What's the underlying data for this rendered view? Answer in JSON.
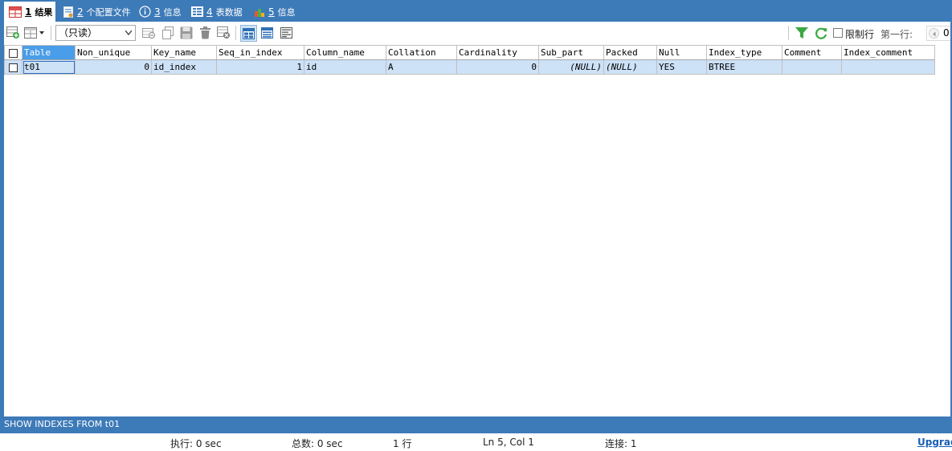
{
  "tabs": [
    {
      "num": "1",
      "label": "结果",
      "icon": "grid-result-icon",
      "active": true
    },
    {
      "num": "2",
      "label": "个配置文件",
      "icon": "profile-icon"
    },
    {
      "num": "3",
      "label": "信息",
      "icon": "info-icon"
    },
    {
      "num": "4",
      "label": "表数据",
      "icon": "table-data-icon"
    },
    {
      "num": "5",
      "label": "信息",
      "icon": "info-chart-icon"
    }
  ],
  "toolbar": {
    "mode_value": "（只读）",
    "limit_rows_label": "限制行",
    "first_row_label": "第一行:",
    "first_row_value": "0"
  },
  "grid": {
    "columns": [
      "Table",
      "Non_unique",
      "Key_name",
      "Seq_in_index",
      "Column_name",
      "Collation",
      "Cardinality",
      "Sub_part",
      "Packed",
      "Null",
      "Index_type",
      "Comment",
      "Index_comment"
    ],
    "rows": [
      [
        "t01",
        "0",
        "id_index",
        "1",
        "id",
        "A",
        "0",
        "(NULL)",
        "(NULL)",
        "YES",
        "BTREE",
        "",
        ""
      ]
    ]
  },
  "sql_text": "SHOW INDEXES FROM t01",
  "status": {
    "exec": "执行: 0 sec",
    "total": "总数: 0 sec",
    "rows": "1 行",
    "position": "Ln 5, Col 1",
    "connection": "连接: 1",
    "upgrade": "Upgrad"
  },
  "colors": {
    "frame": "#3d7ab8",
    "row_selected": "#cde1f7",
    "header_selected": "#4a9de8",
    "link": "#1a5fb4"
  }
}
